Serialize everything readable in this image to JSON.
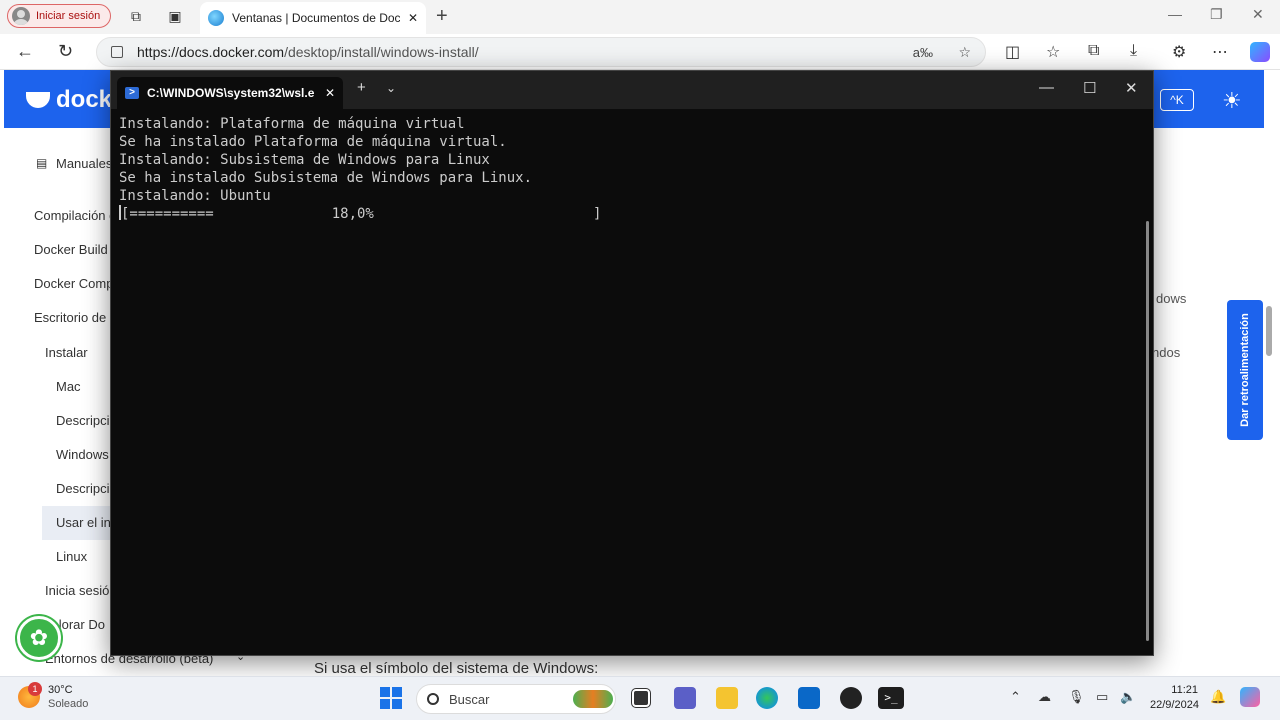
{
  "browser": {
    "profile_label": "Iniciar sesión",
    "tab_title": "Ventanas | Documentos de Docker",
    "url_host": "https://docs.docker.com",
    "url_path": "/desktop/install/windows-install/"
  },
  "docker_page": {
    "logo_text": "docke",
    "search_shortcut": "^K",
    "sidebar": [
      {
        "label": "Manuales"
      },
      {
        "label": "Compilación d"
      },
      {
        "label": "Docker Build C"
      },
      {
        "label": "Docker Comp"
      },
      {
        "label": "Escritorio de D"
      },
      {
        "label": "Instalar"
      },
      {
        "label": "Mac"
      },
      {
        "label": "Descripci"
      },
      {
        "label": "Windows"
      },
      {
        "label": "Descripci"
      },
      {
        "label": "Usar el ins"
      },
      {
        "label": "Linux"
      },
      {
        "label": "Inicia sesió"
      },
      {
        "label": "xplorar Do"
      },
      {
        "label": "Entornos de desarrollo (beta)"
      }
    ],
    "right_fragments": [
      "dows",
      "ndos"
    ],
    "feedback_label": "Dar retroalimentación",
    "bottom_text": "Si usa el símbolo del sistema de Windows:"
  },
  "terminal": {
    "tab_title": "C:\\WINDOWS\\system32\\wsl.e",
    "lines": [
      "Instalando: Plataforma de máquina virtual",
      "Se ha instalado Plataforma de máquina virtual.",
      "Instalando: Subsistema de Windows para Linux",
      "Se ha instalado Subsistema de Windows para Linux.",
      "Instalando: Ubuntu"
    ],
    "progress_line": "[==========              18,0%                          ]"
  },
  "taskbar": {
    "weather_temp": "30°C",
    "weather_desc": "Soleado",
    "weather_badge": "1",
    "search_label": "Buscar",
    "time": "11:21",
    "date": "22/9/2024"
  }
}
